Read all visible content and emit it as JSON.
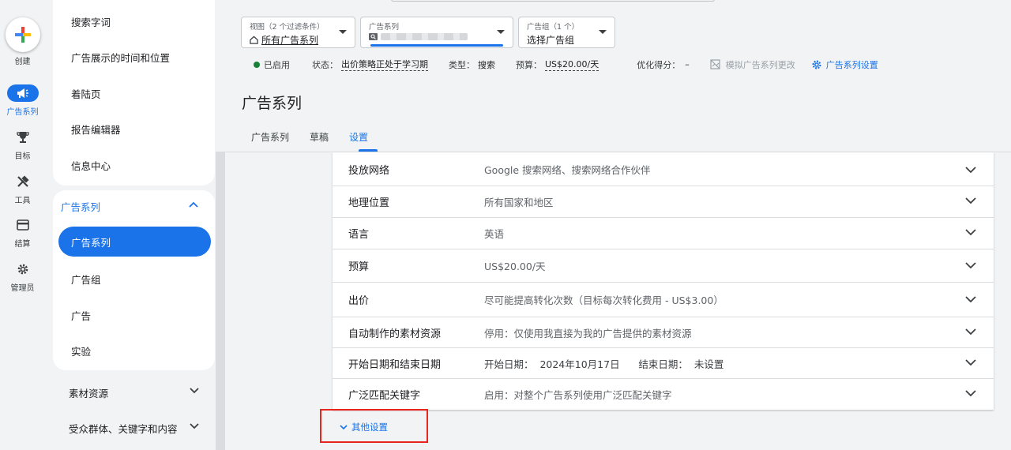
{
  "rail": {
    "create_label": "创建",
    "items": [
      {
        "label": "广告系列",
        "icon": "megaphone-icon",
        "active": true
      },
      {
        "label": "目标",
        "icon": "trophy-icon"
      },
      {
        "label": "工具",
        "icon": "tools-icon"
      },
      {
        "label": "结算",
        "icon": "credit-card-icon"
      },
      {
        "label": "管理员",
        "icon": "gear-icon"
      }
    ]
  },
  "nav": {
    "top_items": [
      "搜索字词",
      "广告展示的时间和位置",
      "着陆页",
      "报告编辑器",
      "信息中心"
    ],
    "section_title": "广告系列",
    "active_item": "广告系列",
    "section_items": [
      "广告组",
      "广告",
      "实验"
    ],
    "collapsed_sections": [
      "素材资源",
      "受众群体、关键字和内容"
    ]
  },
  "filters": {
    "view": {
      "caption": "视图（2 个过滤条件）",
      "value": "所有广告系列"
    },
    "campaign": {
      "caption": "广告系列"
    },
    "adgroup": {
      "caption": "广告组（1 个）",
      "value": "选择广告组"
    }
  },
  "status": {
    "enabled": "已启用",
    "status_label": "状态：",
    "status_value": "出价策略正处于学习期",
    "type_label": "类型：",
    "type_value": "搜索",
    "budget_label": "预算：",
    "budget_value": "US$20.00/天",
    "score_label": "优化得分：",
    "score_value": "–",
    "simulate": "模拟广告系列更改",
    "settings_link": "广告系列设置"
  },
  "page_title": "广告系列",
  "tabs": [
    "广告系列",
    "草稿",
    "设置"
  ],
  "active_tab": "设置",
  "settings_rows": [
    {
      "key": "投放网络",
      "value": "Google 搜索网络、搜索网络合作伙伴"
    },
    {
      "key": "地理位置",
      "value": "所有国家和地区"
    },
    {
      "key": "语言",
      "value": "英语"
    },
    {
      "key": "预算",
      "value": "US$20.00/天"
    },
    {
      "key": "出价",
      "value": "尽可能提高转化次数（目标每次转化费用 - US$3.00）"
    },
    {
      "key": "自动制作的素材资源",
      "value": "停用：仅使用我直接为我的广告提供的素材资源"
    },
    {
      "key": "开始日期和结束日期",
      "value": "开始日期：  2024年10月17日      结束日期：  未设置"
    },
    {
      "key": "广泛匹配关键字",
      "value": "启用：对整个广告系列使用广泛匹配关键字"
    }
  ],
  "more_settings": "其他设置",
  "colors": {
    "accent": "#1a73e8",
    "enabled": "#188038",
    "highlight": "#e8261f"
  }
}
